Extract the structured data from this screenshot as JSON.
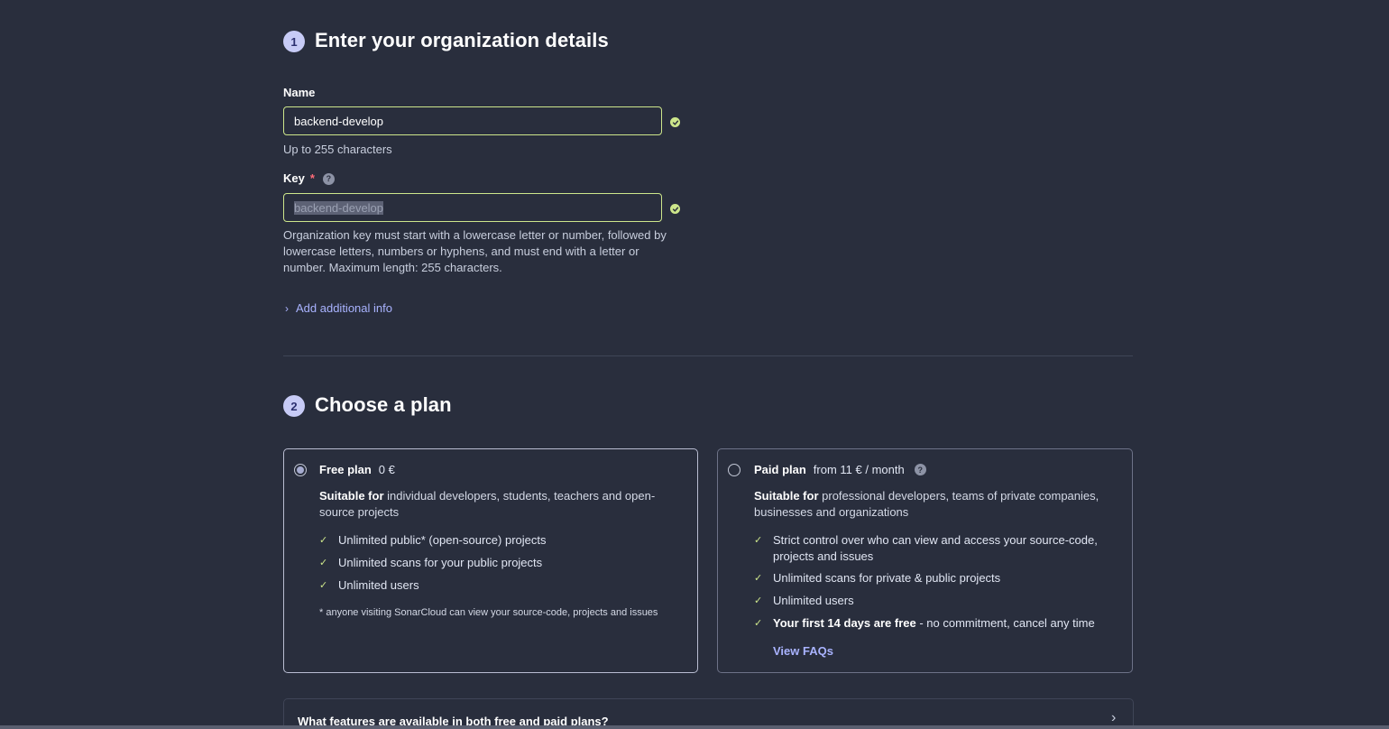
{
  "step1": {
    "number": "1",
    "title": "Enter your organization details",
    "name_label": "Name",
    "name_value": "backend-develop",
    "name_hint": "Up to 255 characters",
    "key_label": "Key",
    "key_required_mark": "*",
    "help_glyph": "?",
    "key_value": "backend-develop",
    "key_hint_line1": "Organization key must start with a lowercase letter or number, followed by",
    "key_hint_line2": "lowercase letters, numbers or hyphens, and must end with a letter or",
    "key_hint_line3": "number. Maximum length: 255 characters.",
    "additional_info": "Add additional info"
  },
  "step2": {
    "number": "2",
    "title": "Choose a plan",
    "free": {
      "name": "Free plan",
      "price": "0 €",
      "selected": true,
      "desc_bold": "Suitable for",
      "desc_line1": "individual developers, students, teachers and open-",
      "desc_line2": "source projects",
      "features": [
        "Unlimited public* (open-source) projects",
        "Unlimited scans for your public projects",
        "Unlimited users"
      ],
      "footnote": "* anyone visiting SonarCloud can view your source-code, projects and issues"
    },
    "paid": {
      "name": "Paid plan",
      "price": "from 11 € / month",
      "selected": false,
      "desc_bold": "Suitable for",
      "desc_line1": "professional developers, teams of private companies,",
      "desc_line2": "businesses and organizations",
      "feature1_line1": "Strict control over who can view and access your source-code,",
      "feature1_line2": "projects and issues",
      "feature2": "Unlimited scans for private & public projects",
      "feature3": "Unlimited users",
      "feature4_bold": "Your first 14 days are free",
      "feature4_rest": " - no commitment, cancel any time",
      "faq_link": "View FAQs"
    },
    "accordion_question": "What features are available in both free and paid plans?"
  },
  "icons": {
    "check": "check-icon",
    "valid": "check-circle-icon",
    "help": "question-circle-icon",
    "chevron": "chevron-right-icon"
  },
  "colors": {
    "background": "#292e3d",
    "valid": "#cde68b",
    "link": "#a9b3ff",
    "step_badge": "#c7cbf6"
  }
}
